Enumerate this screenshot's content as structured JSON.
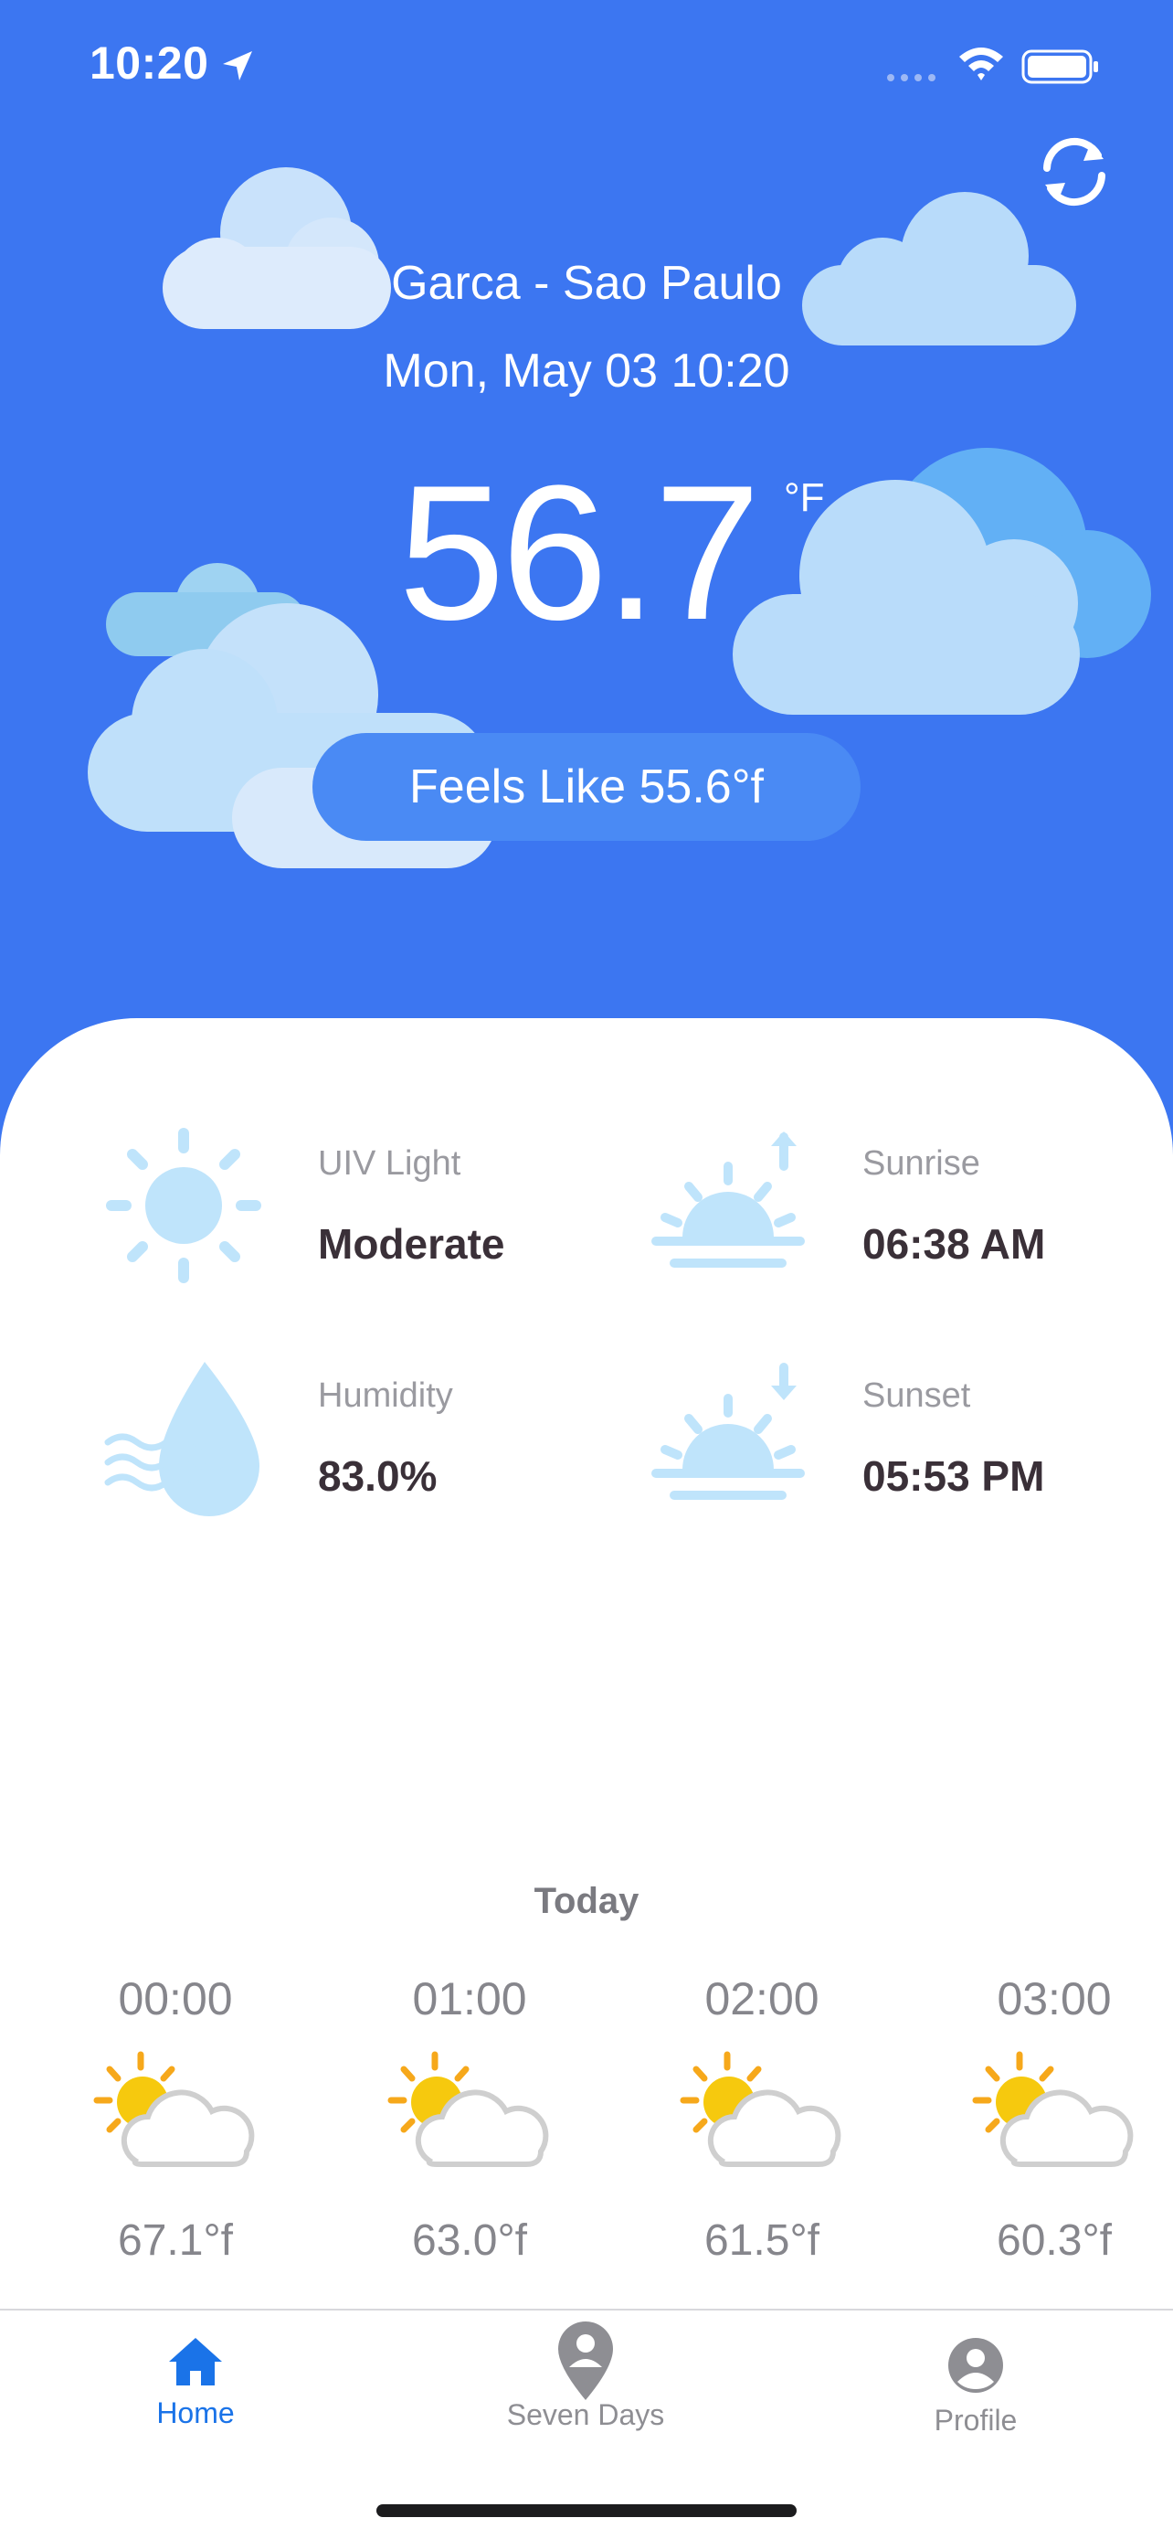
{
  "status_bar": {
    "time": "10:20"
  },
  "header": {
    "city": "Garca - Sao Paulo",
    "datetime": "Mon, May 03 10:20",
    "temperature": "56.7",
    "unit": "°F",
    "feels_like": "Feels Like 55.6°f"
  },
  "details": {
    "uv": {
      "label": "UIV Light",
      "value": "Moderate"
    },
    "sunrise": {
      "label": "Sunrise",
      "value": "06:38 AM"
    },
    "humidity": {
      "label": "Humidity",
      "value": "83.0%"
    },
    "sunset": {
      "label": "Sunset",
      "value": "05:53 PM"
    }
  },
  "today": {
    "title": "Today",
    "hours": [
      {
        "time": "00:00",
        "temp": "67.1°f",
        "icon": "partly-cloudy-icon"
      },
      {
        "time": "01:00",
        "temp": "63.0°f",
        "icon": "partly-cloudy-icon"
      },
      {
        "time": "02:00",
        "temp": "61.5°f",
        "icon": "partly-cloudy-icon"
      },
      {
        "time": "03:00",
        "temp": "60.3°f",
        "icon": "partly-cloudy-icon"
      }
    ]
  },
  "tabs": [
    {
      "label": "Home",
      "icon": "home-icon",
      "active": true
    },
    {
      "label": "Seven Days",
      "icon": "location-pin-icon",
      "active": false
    },
    {
      "label": "Profile",
      "icon": "person-icon",
      "active": false
    }
  ],
  "colors": {
    "hero_bg": "#3C76F1",
    "accent": "#1A73E8",
    "icon_light_blue": "#BFE4FB",
    "tab_inactive": "#8E8E93"
  }
}
